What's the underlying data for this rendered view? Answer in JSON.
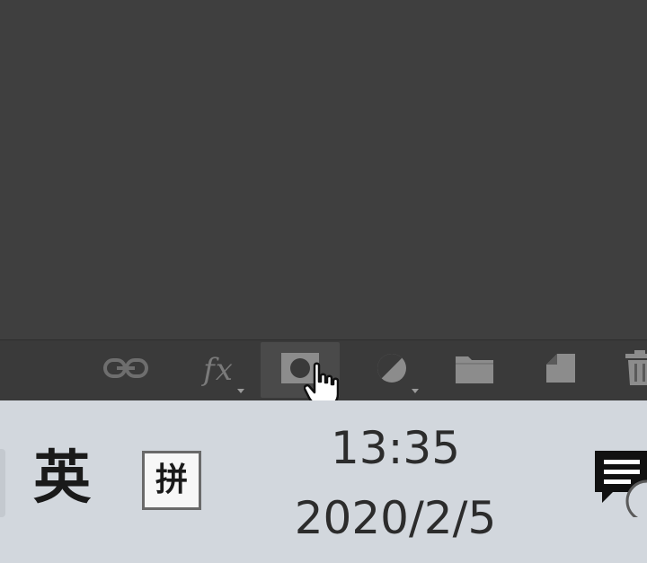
{
  "layers_panel": {
    "toolbar": {
      "link_icon": "link-layers-icon",
      "fx_label": "fx",
      "mask_icon": "add-layer-mask-icon",
      "adjust_icon": "adjustment-layer-icon",
      "group_icon": "folder-icon",
      "new_layer_icon": "new-layer-icon",
      "trash_icon": "trash-icon"
    }
  },
  "taskbar": {
    "ime_language": "英",
    "ime_mode": "拼",
    "clock": {
      "time": "13:35",
      "date": "2020/2/5"
    },
    "notification_icon": "action-center-icon"
  },
  "colors": {
    "panel_bg": "#3f3f3f",
    "toolbar_bg": "#3a3a3a",
    "icon_color": "#8a8a8a",
    "taskbar_bg": "#d2d7dd",
    "clock_text": "#2c2c2c"
  }
}
